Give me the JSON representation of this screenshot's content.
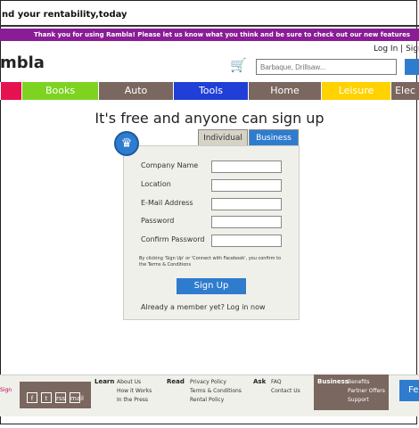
{
  "browser_title": "nd your rentability,today",
  "banner_text": "Thank you for using Rambla! Please let us know what you think and be sure to check out our new features",
  "logo": "mbla",
  "header": {
    "login": "Log In",
    "sep": "|",
    "signup": "Sign"
  },
  "search": {
    "placeholder": "Barbaque, Drillsaw..."
  },
  "nav": [
    {
      "label": "",
      "color": "#e6124f"
    },
    {
      "label": "Books",
      "color": "#7ed321"
    },
    {
      "label": "Auto",
      "color": "#7a675f"
    },
    {
      "label": "Tools",
      "color": "#1f3fd6"
    },
    {
      "label": "Home",
      "color": "#7a675f"
    },
    {
      "label": "Leisure",
      "color": "#ffd200"
    },
    {
      "label": "Elec",
      "color": "#7a675f"
    }
  ],
  "tagline": "It's free and anyone can sign up",
  "tabs": {
    "individual": "Individual",
    "business": "Business"
  },
  "form": {
    "fields": [
      "Company Name",
      "Location",
      "E-Mail Address",
      "Password",
      "Confirm Password"
    ],
    "terms": "By clicking 'Sign Up' or 'Connect with Facebook', you confirm to the Terms & Conditions",
    "button": "Sign Up",
    "member": "Already a member yet? Log in now"
  },
  "footer": {
    "sign": "Sign",
    "social": [
      "f",
      "t",
      "rss",
      "mail"
    ],
    "learn": {
      "head": "Learn",
      "links": [
        "About Us",
        "How it Works",
        "In the Press"
      ]
    },
    "read": {
      "head": "Read",
      "links": [
        "Privacy Policy",
        "Terms & Conditions",
        "Rental Policy"
      ]
    },
    "ask": {
      "head": "Ask",
      "links": [
        "FAQ",
        "Contact Us"
      ]
    },
    "business": {
      "head": "Business",
      "links": [
        "Benefits",
        "Partner Offers",
        "Support"
      ]
    },
    "right": "Fe"
  }
}
